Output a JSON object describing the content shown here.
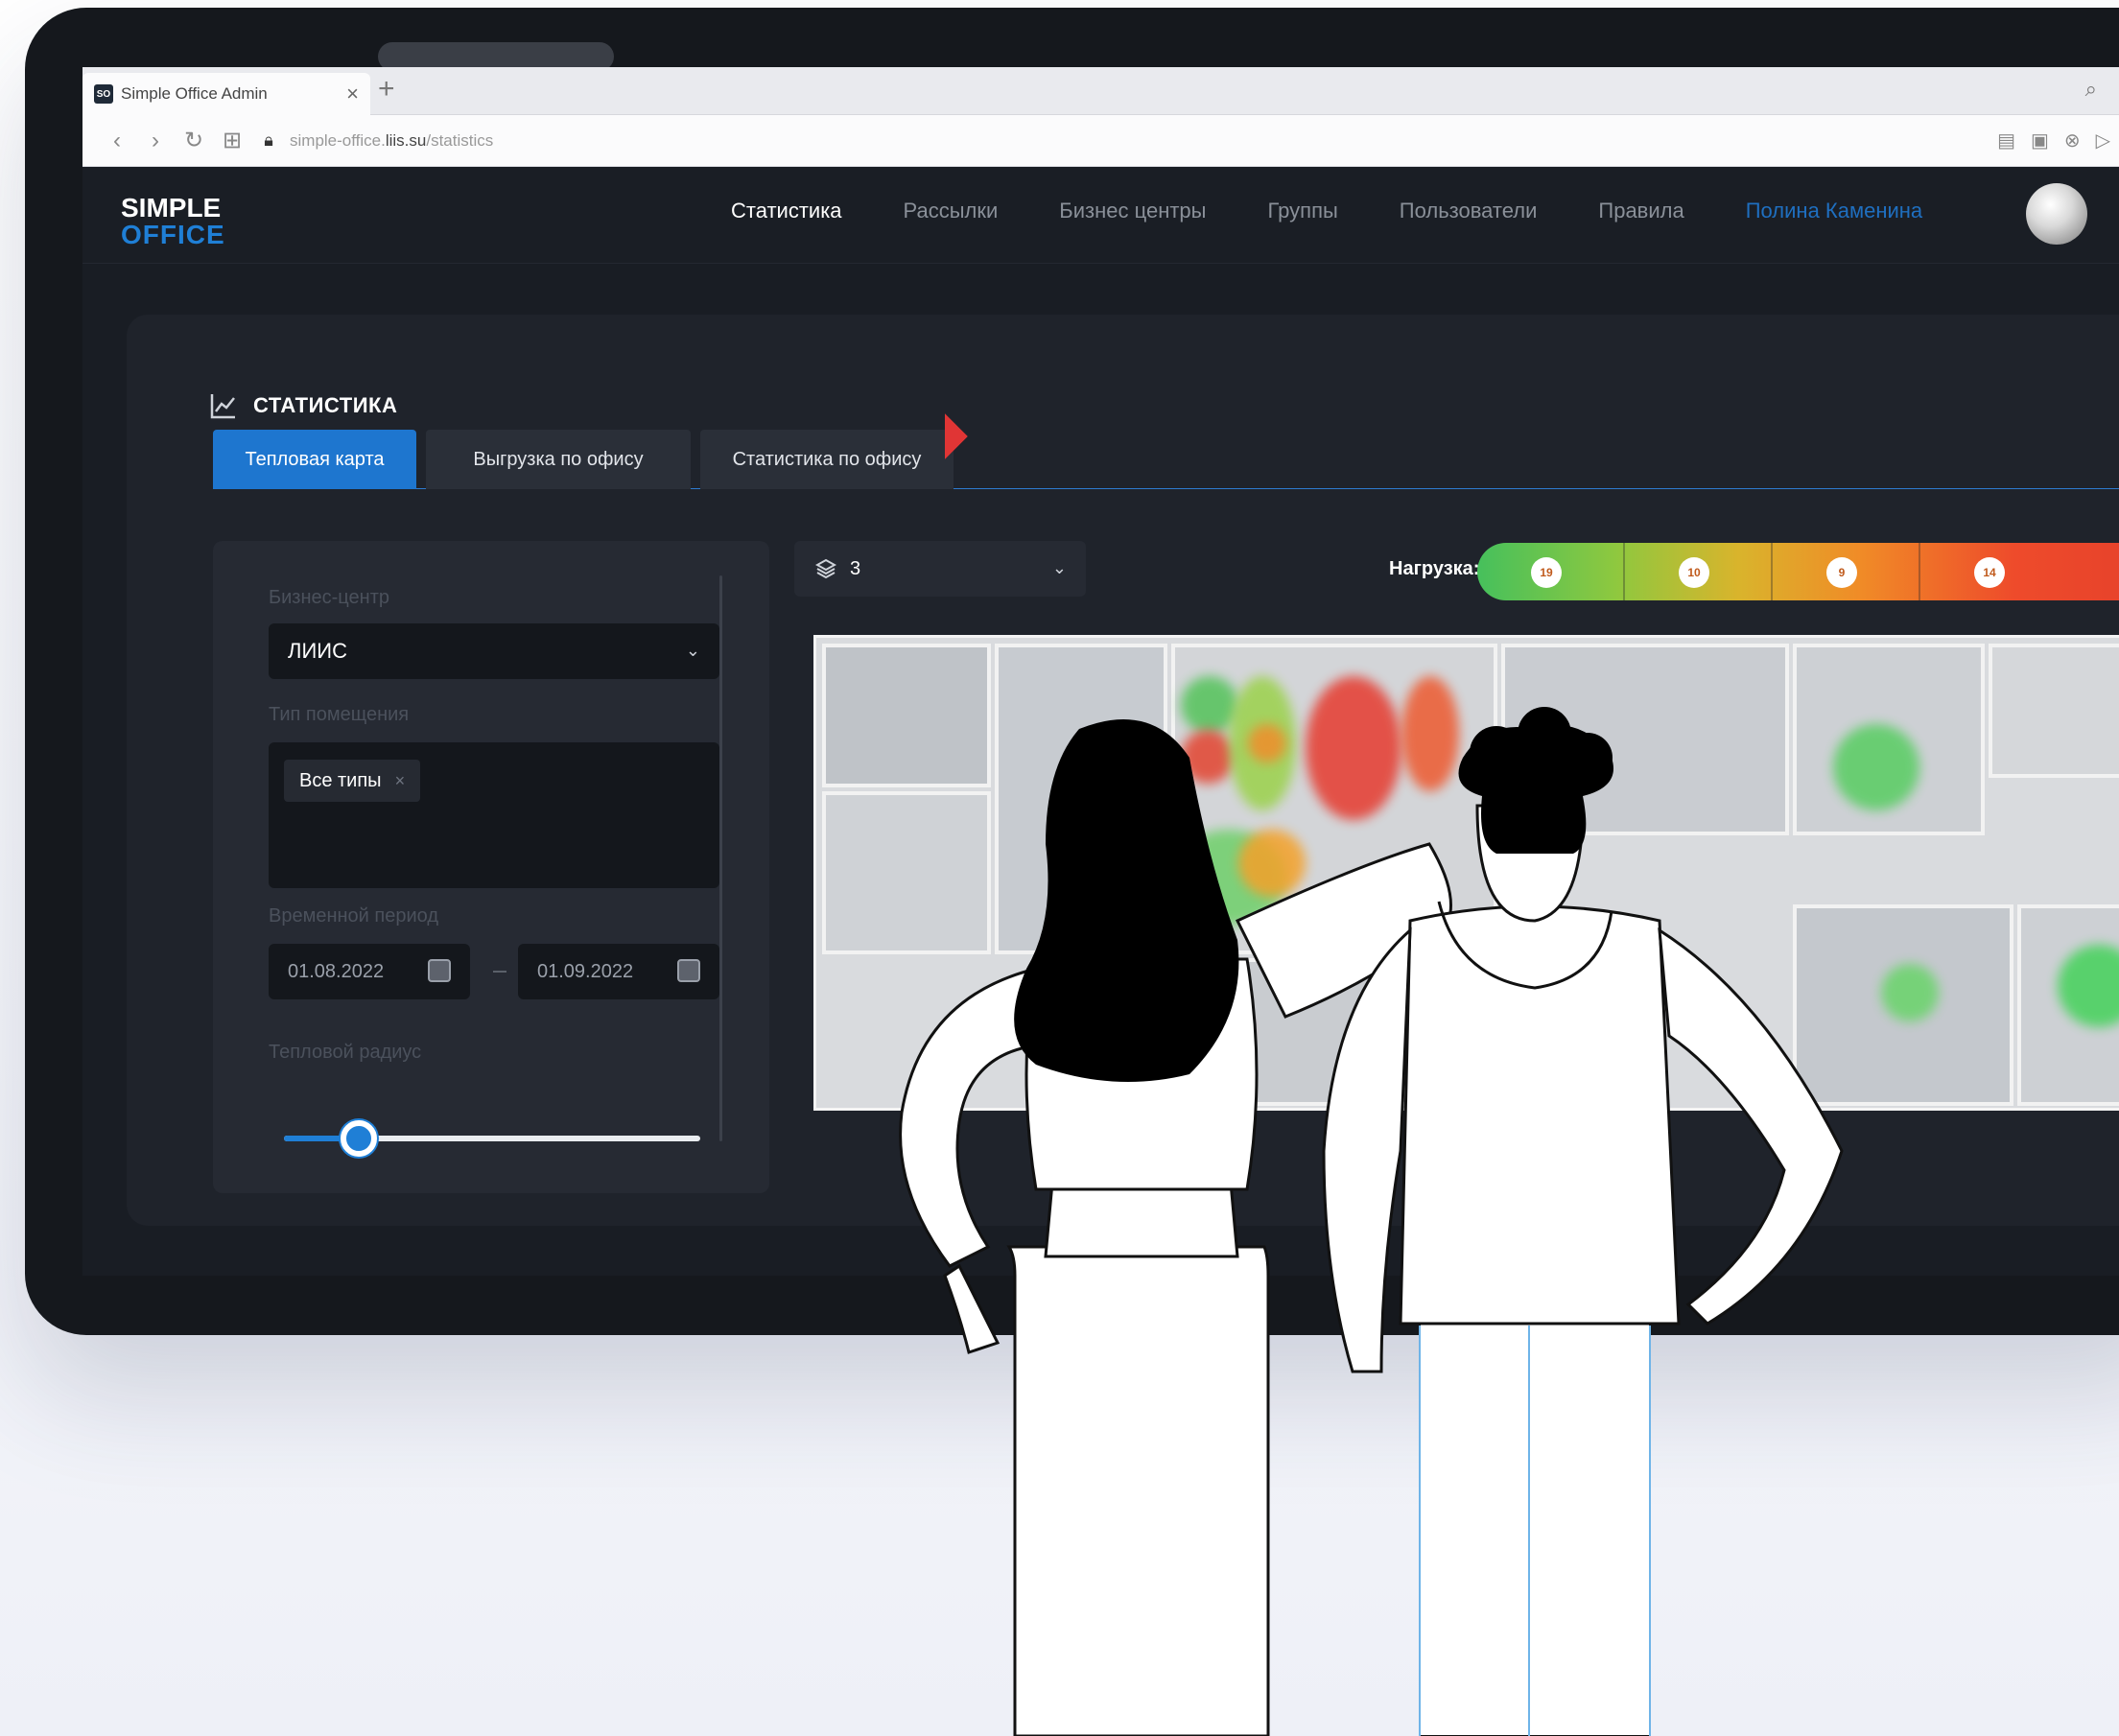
{
  "browser": {
    "tab_title": "Simple Office Admin",
    "favicon_text": "SO",
    "url_prefix": "simple-office.",
    "url_domain": "liis.su",
    "url_path": "/statistics"
  },
  "app": {
    "logo_line1": "SIMPLE",
    "logo_line2": "OFFICE",
    "nav": {
      "statistics": "Статистика",
      "mailings": "Рассылки",
      "business_centers": "Бизнес центры",
      "groups": "Группы",
      "users": "Пользователи",
      "rules": "Правила",
      "user_name": "Полина Каменина"
    }
  },
  "page": {
    "title": "СТАТИСТИКА",
    "tabs": {
      "heatmap": "Тепловая карта",
      "export": "Выгрузка по офису",
      "office_stats": "Статистика по офису"
    }
  },
  "filters": {
    "business_center_label": "Бизнес-центр",
    "business_center_value": "ЛИИС",
    "room_type_label": "Тип помещения",
    "room_type_chip": "Все типы",
    "period_label": "Временной период",
    "date_from": "01.08.2022",
    "date_to": "01.09.2022",
    "radius_label": "Тепловой радиус",
    "radius_value_fraction": 0.18
  },
  "floor": {
    "selected": "3"
  },
  "load": {
    "label": "Нагрузка:",
    "counts": [
      "19",
      "10",
      "9",
      "14"
    ]
  },
  "colors": {
    "accent": "#1f7fd6",
    "background": "#191d24",
    "panel": "#1f232b",
    "load_low": "#46c05c",
    "load_high": "#e03a2b"
  },
  "icons": {
    "chart": "line-chart-icon",
    "layers": "layers-icon",
    "zoom_in": "plus-icon",
    "zoom_out": "minus-icon"
  }
}
